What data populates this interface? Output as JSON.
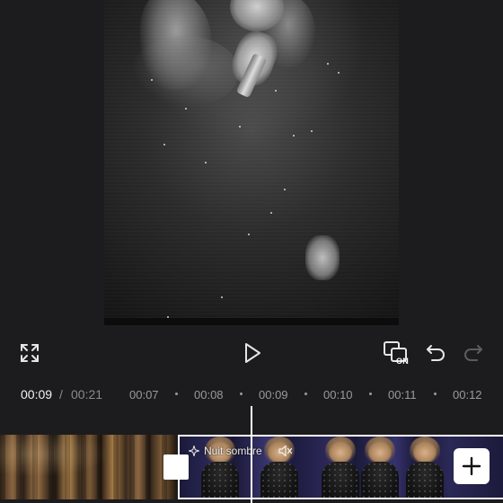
{
  "preview": {
    "effect_style": "dark-glitch"
  },
  "controls": {
    "fullscreen_icon": "fullscreen-icon",
    "play_icon": "play-icon",
    "keyframe_icon": "keyframe-icon",
    "keyframe_badge": "ON",
    "undo_icon": "undo-icon",
    "redo_icon": "redo-icon"
  },
  "timecode": {
    "current": "00:09",
    "separator": "/",
    "total": "00:21"
  },
  "ruler": {
    "ticks": [
      "00:07",
      "00:08",
      "00:09",
      "00:10",
      "00:11",
      "00:12"
    ]
  },
  "timeline": {
    "clip_b_label": "Nuit sombre",
    "effect_icon": "sparkle-icon",
    "mute_icon": "mute-icon",
    "add_icon": "plus-icon"
  },
  "colors": {
    "background": "#1c1c1e",
    "accent": "#ffffff",
    "muted_text": "#9a9a9a"
  }
}
